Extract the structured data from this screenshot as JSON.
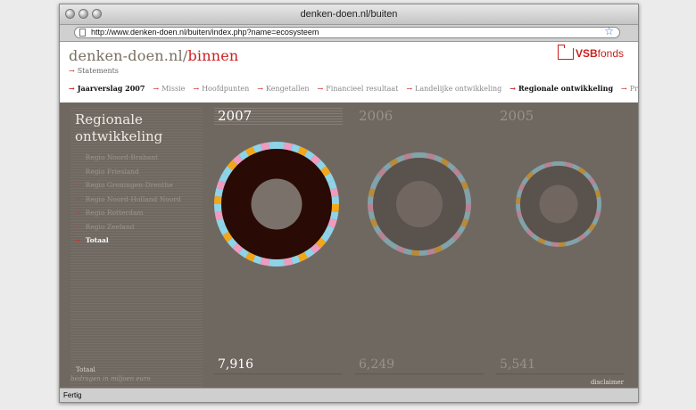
{
  "browser": {
    "window_title": "denken-doen.nl/buiten",
    "url": "http://www.denken-doen.nl/buiten/index.php?name=ecosysteem",
    "status": "Fertig"
  },
  "header": {
    "site_name": "denken-doen.nl/",
    "site_section": "binnen",
    "logo_bold": "VSB",
    "logo_regular": "fonds"
  },
  "nav_top": [
    "Statements"
  ],
  "nav_main": [
    {
      "label": "Jaarverslag 2007",
      "active": true
    },
    {
      "label": "Missie",
      "active": false
    },
    {
      "label": "Hoofdpunten",
      "active": false
    },
    {
      "label": "Kengetallen",
      "active": false
    },
    {
      "label": "Financieel resultaat",
      "active": false
    },
    {
      "label": "Landelijke ontwikkeling",
      "active": false
    },
    {
      "label": "Regionale ontwikkeling",
      "active": true
    },
    {
      "label": "Projecten",
      "active": false
    }
  ],
  "sidebar": {
    "title_line1": "Regionale",
    "title_line2": "ontwikkeling",
    "regions": [
      {
        "label": "Regio Noord-Brabant",
        "current": false
      },
      {
        "label": "Regio Friesland",
        "current": false
      },
      {
        "label": "Regio Groningen-Drenthe",
        "current": false
      },
      {
        "label": "Regio Noord-Holland Noord",
        "current": false
      },
      {
        "label": "Regio Rotterdam",
        "current": false
      },
      {
        "label": "Regio Zeeland",
        "current": false
      },
      {
        "label": "Totaal",
        "current": true
      }
    ],
    "total_label": "Totaal",
    "footnote": "bedragen in miljoen euro"
  },
  "years": [
    {
      "year": "2007",
      "total": "7,916",
      "highlight": true
    },
    {
      "year": "2006",
      "total": "6,249",
      "highlight": false
    },
    {
      "year": "2005",
      "total": "5,541",
      "highlight": false
    }
  ],
  "colors": {
    "ring_blue": "#8fd3e6",
    "ring_pink": "#ef9bc0",
    "ring_orange": "#f2a71b",
    "disc_dark": "#2a0a04",
    "disc_gray": "#7a716a",
    "disc_mid": "#5a524c"
  },
  "disclaimer": "disclaimer"
}
